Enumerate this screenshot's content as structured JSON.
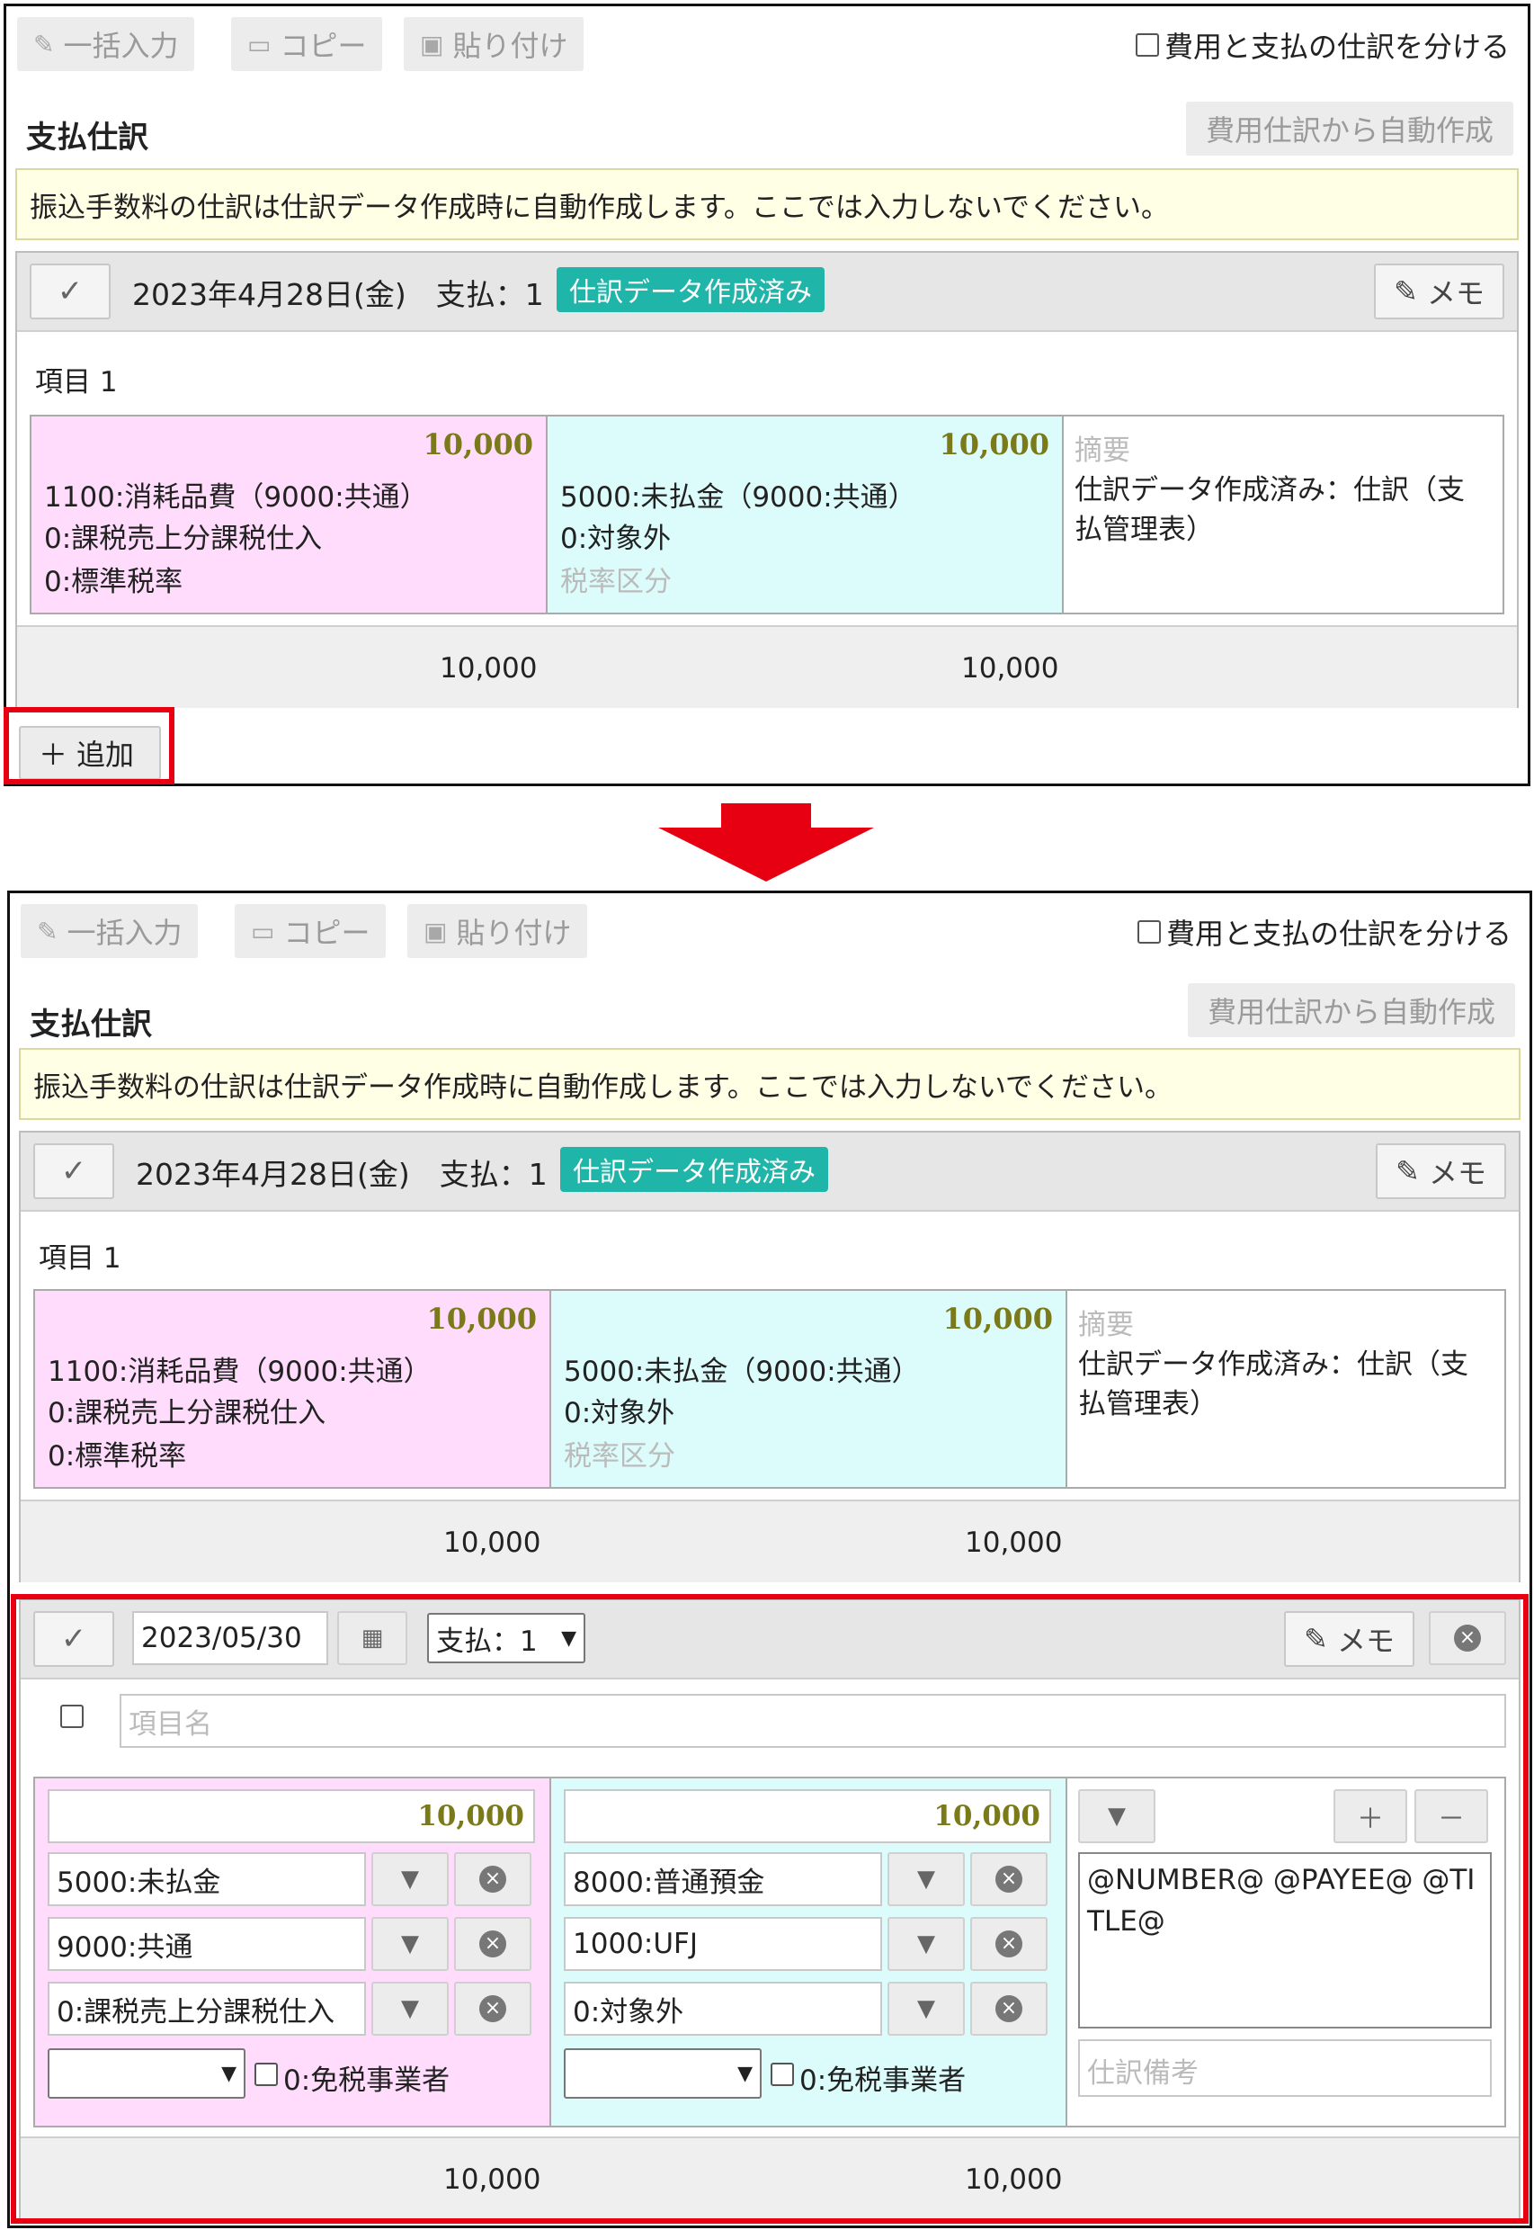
{
  "toolbar": {
    "bulk_label": "一括入力",
    "copy_label": "コピー",
    "paste_label": "貼り付け",
    "separate_label": "費用と支払の仕訳を分ける"
  },
  "section": {
    "title": "支払仕訳",
    "auto_create_label": "費用仕訳から自動作成",
    "notice": "振込手数料の仕訳は仕訳データ作成時に自動作成します。ここでは入力しないでください。"
  },
  "entry": {
    "title": "2023年4月28日(金)　支払：1",
    "badge": "仕訳データ作成済み",
    "memo_label": "メモ",
    "item_label": "項目 1",
    "debit": {
      "amount": "10,000",
      "line1": "1100:消耗品費（9000:共通）",
      "line2": "0:課税売上分課税仕入",
      "line3": "0:標準税率"
    },
    "credit": {
      "amount": "10,000",
      "line1": "5000:未払金（9000:共通）",
      "line2": "0:対象外",
      "line3": "税率区分"
    },
    "memo_col": {
      "placeholder": "摘要",
      "text": "仕訳データ作成済み：仕訳（支払管理表）"
    },
    "totals": {
      "debit": "10,000",
      "credit": "10,000"
    }
  },
  "add_label": "追加",
  "new_entry": {
    "date": "2023/05/30",
    "payment_select": "支払：1",
    "memo_label": "メモ",
    "item_name_placeholder": "項目名",
    "debit": {
      "amount": "10,000",
      "account": "5000:未払金",
      "dept": "9000:共通",
      "tax": "0:課税売上分課税仕入",
      "exempt_label": "0:免税事業者"
    },
    "credit": {
      "amount": "10,000",
      "account": "8000:普通預金",
      "dept": "1000:UFJ",
      "tax": "0:対象外",
      "exempt_label": "0:免税事業者"
    },
    "memo_text": "@NUMBER@ @PAYEE@ @TITLE@",
    "remark_placeholder": "仕訳備考",
    "totals": {
      "debit": "10,000",
      "credit": "10,000"
    }
  },
  "icons": [
    "pencil-icon",
    "copy-icon",
    "paste-icon",
    "check-icon",
    "memo-icon",
    "plus-icon",
    "calendar-icon",
    "chevron-down-icon",
    "close-icon",
    "minus-icon"
  ],
  "colors": {
    "debit_bg": "#ffdcfb",
    "credit_bg": "#dcfcfc",
    "badge": "#1fb5a8",
    "highlight": "#e60012",
    "amount": "#7a7a1a"
  }
}
